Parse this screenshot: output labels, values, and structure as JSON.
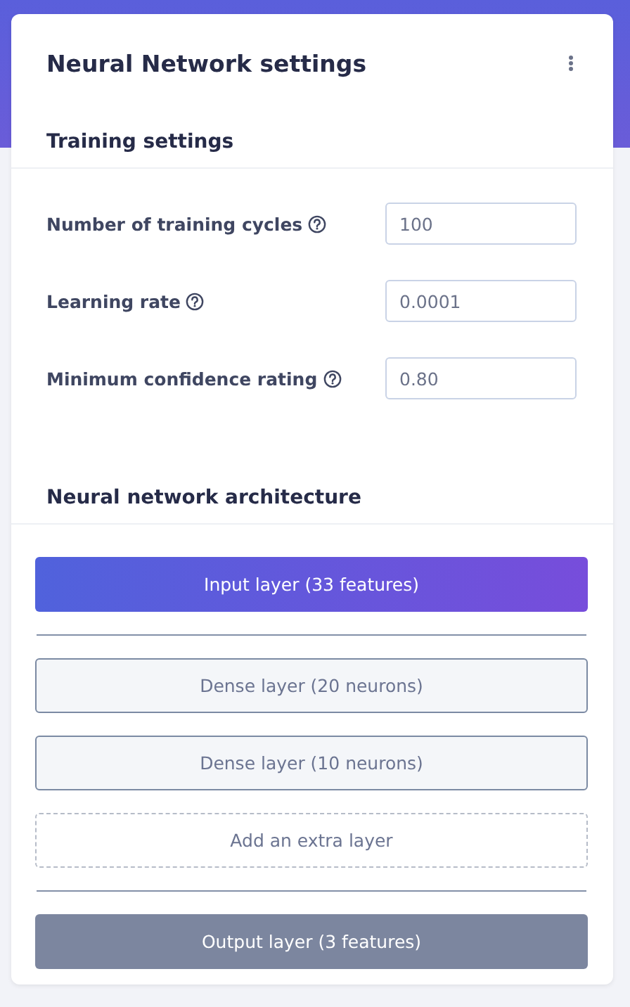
{
  "card": {
    "title": "Neural Network settings"
  },
  "training_settings": {
    "heading": "Training settings",
    "fields": [
      {
        "label": "Number of training cycles",
        "value": "100"
      },
      {
        "label": "Learning rate",
        "value": "0.0001"
      },
      {
        "label": "Minimum confidence rating",
        "value": "0.80"
      }
    ]
  },
  "architecture": {
    "heading": "Neural network architecture",
    "layers": [
      {
        "kind": "input",
        "label": "Input layer (33 features)"
      },
      {
        "kind": "dense",
        "label": "Dense layer (20 neurons)"
      },
      {
        "kind": "dense",
        "label": "Dense layer (10 neurons)"
      },
      {
        "kind": "add",
        "label": "Add an extra layer"
      },
      {
        "kind": "output",
        "label": "Output layer (3 features)"
      }
    ]
  }
}
